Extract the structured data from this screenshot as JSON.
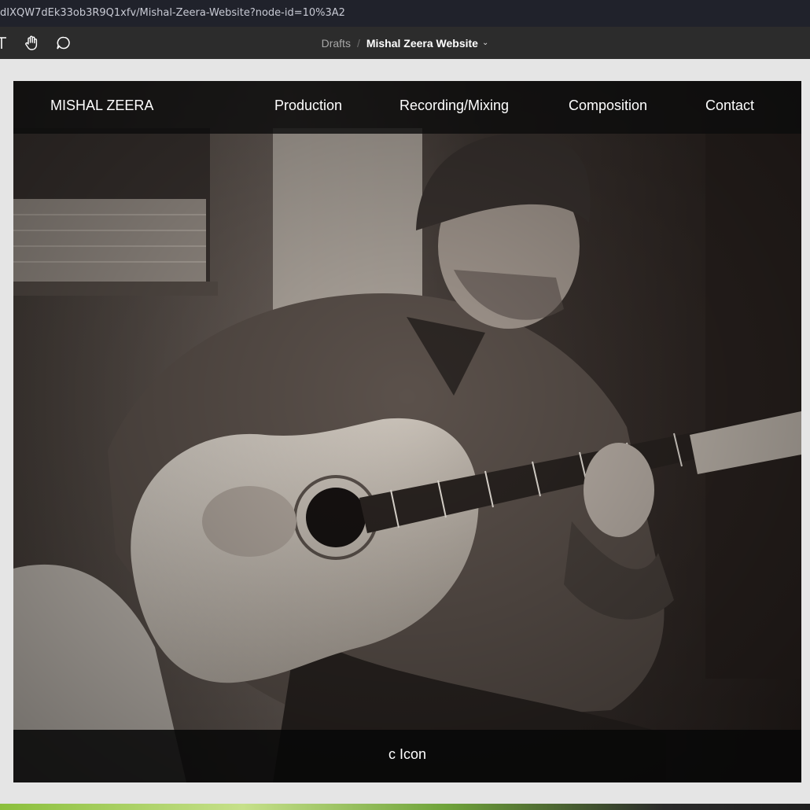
{
  "browser": {
    "url": "dIXQW7dEk33ob3R9Q1xfv/Mishal-Zeera-Website?node-id=10%3A2"
  },
  "toolbar": {
    "icons": [
      "text-tool-icon",
      "hand-icon",
      "comment-icon"
    ],
    "breadcrumb": {
      "parent": "Drafts",
      "separator": "/",
      "file": "Mishal Zeera Website",
      "chevron": "⌄"
    }
  },
  "site": {
    "brand": "MISHAL ZEERA",
    "nav": [
      {
        "label": "Production"
      },
      {
        "label": "Recording/Mixing"
      },
      {
        "label": "Composition"
      },
      {
        "label": "Contact"
      }
    ],
    "hero_image": "guitarist-photo",
    "footer_text": "c Icon"
  },
  "colors": {
    "canvas": "#e5e5e5",
    "toolbar": "#2c2c2c",
    "urlbar": "#20222b",
    "nav_overlay": "#0c0c0c"
  }
}
